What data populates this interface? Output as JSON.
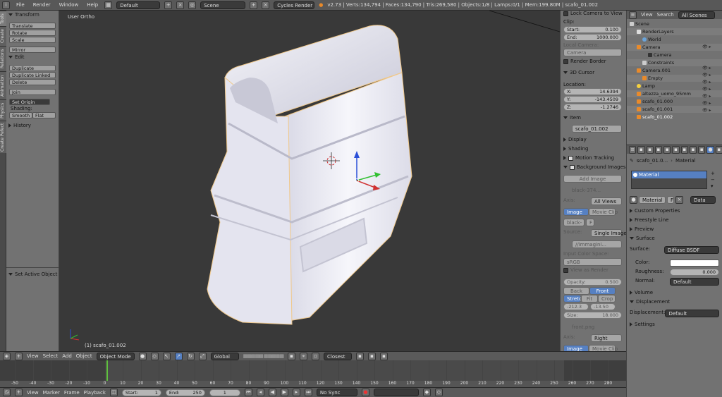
{
  "topbar": {
    "menus": [
      "File",
      "Render",
      "Window",
      "Help"
    ],
    "layout": "Default",
    "scene": "Scene",
    "engine": "Cycles Render",
    "stats": "v2.73 | Verts:134,794 | Faces:134,790 | Tris:269,580 | Objects:1/8 | Lamps:0/1 | Mem:199.80M | scafo_01.002"
  },
  "lefttabs": [
    "Tools",
    "Create",
    "Relations",
    "Animation",
    "Physics",
    "Create Pefect"
  ],
  "toolshelf": {
    "transform_header": "Transform",
    "transform_buttons": [
      "Translate",
      "Rotate",
      "Scale"
    ],
    "mirror": "Mirror",
    "edit_header": "Edit",
    "edit_buttons": [
      "Duplicate",
      "Duplicate Linked",
      "Delete"
    ],
    "join": "Join",
    "set_origin": "Set Origin",
    "shading_label": "Shading:",
    "smooth": "Smooth",
    "flat": "Flat",
    "history_header": "History",
    "operator_panel": "Set Active Object as Ca"
  },
  "viewport": {
    "view_label": "User Ortho",
    "object_label": "(1) scafo_01.002"
  },
  "npanel": {
    "lock_camera": "Lock Camera to View",
    "clip_label": "Clip:",
    "start_label": "Start:",
    "start_value": "0.100",
    "end_label": "End:",
    "end_value": "1000.000",
    "local_camera": "Local Camera:",
    "camera_field": "Camera",
    "render_border": "Render Border",
    "cursor_header": "3D Cursor",
    "location_label": "Location:",
    "x_label": "X:",
    "x_value": "14.6394",
    "y_label": "Y:",
    "y_value": "-143.4509",
    "z_label": "Z:",
    "z_value": "-1.2746",
    "item_header": "Item",
    "item_name": "scafo_01.002",
    "display": "Display",
    "shading": "Shading",
    "motion_tracking": "Motion Tracking",
    "bg_images": "Background Images",
    "add_image": "Add Image",
    "bg1_name": "black-374...",
    "axis_label": "Axis:",
    "all_views": "All Views",
    "image_tab": "Image",
    "movieclip_tab": "Movie Clip",
    "black_field": "black-",
    "f_label": "F",
    "source_label": "Source:",
    "single_image": "Single Image",
    "path": "//immagini...",
    "input_color": "Input Color Space:",
    "srgb": "sRGB",
    "view_as_render": "View as Render",
    "opacity_label": "Opacity:",
    "opacity_value": "0.500",
    "back": "Back",
    "front": "Front",
    "stretch": "Stretch",
    "fit": "Fit",
    "crop": "Crop",
    "off_x": "-212.3",
    "off_y": "-13.50",
    "size_label": "Size:",
    "size_value": "18.000",
    "bg2_name": "front.png",
    "axis2_value": "Right",
    "image_tab2": "Image",
    "movieclip_tab2": "Movie Clip"
  },
  "outliner": {
    "view": "View",
    "search": "Search",
    "scope": "All Scenes",
    "rows": [
      "Scene",
      "RenderLayers",
      "World",
      "Camera",
      "Camera",
      "Constraints",
      "Camera.001",
      "Empty",
      "Lamp",
      "altezza_uomo_95mm",
      "scafo_01.000",
      "scafo_01.001",
      "scafo_01.002"
    ]
  },
  "props": {
    "breadcrumb_obj": "scafo_01.0...",
    "breadcrumb_mat": "Material",
    "slot_name": "Material",
    "material_field": "Material",
    "f_label": "F",
    "data_label": "Data",
    "custom_props": "Custom Properties",
    "freestyle": "Freestyle Line",
    "preview": "Preview",
    "surface_header": "Surface",
    "surface_label": "Surface:",
    "surface_value": "Diffuse BSDF",
    "color_label": "Color:",
    "roughness_label": "Roughness:",
    "roughness_value": "0.000",
    "normal_label": "Normal:",
    "normal_value": "Default",
    "volume": "Volume",
    "displacement_header": "Displacement",
    "displacement_label": "Displacement:",
    "displacement_value": "Default",
    "settings": "Settings"
  },
  "v3dheader": {
    "view": "View",
    "select": "Select",
    "add": "Add",
    "object": "Object",
    "mode": "Object Mode",
    "orientation": "Global",
    "snap": "Closest"
  },
  "timeline": {
    "ticks": [
      "-50",
      "-40",
      "-30",
      "-20",
      "-10",
      "0",
      "10",
      "20",
      "30",
      "40",
      "50",
      "60",
      "70",
      "80",
      "90",
      "100",
      "110",
      "120",
      "130",
      "140",
      "150",
      "160",
      "170",
      "180",
      "190",
      "200",
      "210",
      "220",
      "230",
      "240",
      "250",
      "260",
      "270",
      "280"
    ]
  },
  "tlheader": {
    "view": "View",
    "marker": "Marker",
    "frame": "Frame",
    "playback": "Playback",
    "start_label": "Start:",
    "start_value": "1",
    "end_label": "End:",
    "end_value": "250",
    "current": "1",
    "sync": "No Sync"
  },
  "colors": {
    "selected_blue": "#5680c2",
    "panel_gray": "#727272",
    "viewport_bg": "#393939"
  }
}
